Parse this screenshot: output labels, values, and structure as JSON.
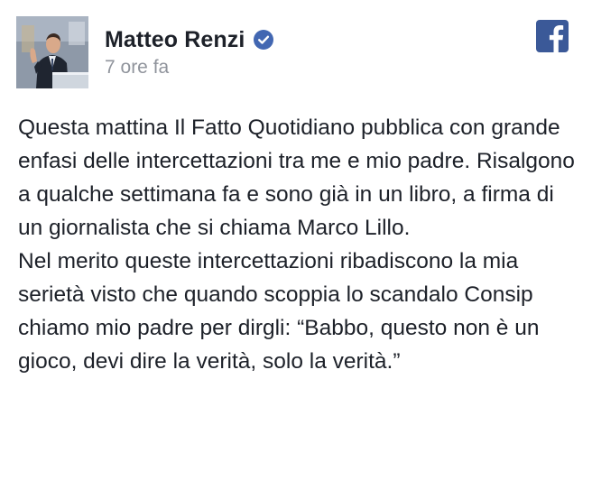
{
  "post": {
    "author": {
      "name": "Matteo Renzi",
      "verified": true,
      "avatar_icon": "profile-photo"
    },
    "timestamp": "7 ore fa",
    "platform_icon": "facebook-icon",
    "paragraphs": [
      "Questa mattina Il Fatto Quotidiano pubblica con grande enfasi delle intercettazioni tra me e mio padre. Risalgono a qualche settimana fa e sono già in un libro, a firma di un giornalista che si chiama Marco Lillo.",
      "Nel merito queste intercettazioni ribadiscono la mia serietà visto che quando scoppia lo scandalo Consip chiamo mio padre per dirgli: “Babbo, questo non è un gioco, devi dire la verità, solo la verità.”"
    ]
  },
  "colors": {
    "text": "#1d2129",
    "timestamp": "#90949c",
    "verified_badge": "#4267b2",
    "facebook_blue": "#3b5998"
  }
}
